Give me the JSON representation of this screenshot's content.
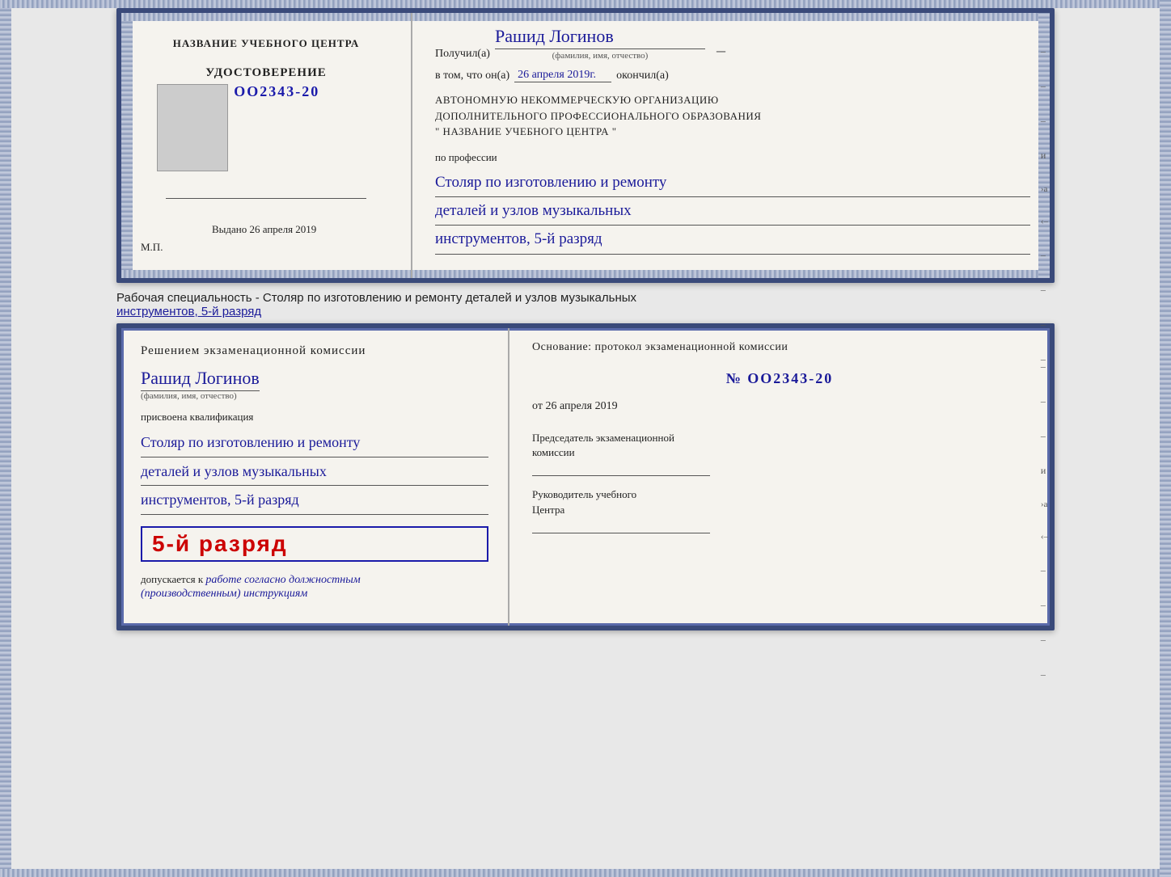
{
  "diploma": {
    "top_card": {
      "left": {
        "title": "НАЗВАНИЕ УЧЕБНОГО ЦЕНТРА",
        "cert_label": "УДОСТОВЕРЕНИЕ",
        "cert_number": "№ OO2343-20",
        "issued_prefix": "Выдано",
        "issued_date": "26 апреля 2019",
        "mp_label": "М.П."
      },
      "right": {
        "received_prefix": "Получил(а)",
        "recipient_name": "Рашид Логинов",
        "recipient_sublabel": "(фамилия, имя, отчество)",
        "date_prefix": "в том, что он(а)",
        "date_value": "26 апреля 2019г.",
        "completed_label": "окончил(а)",
        "org_line1": "АВТОНОМНУЮ НЕКОММЕРЧЕСКУЮ ОРГАНИЗАЦИЮ",
        "org_line2": "ДОПОЛНИТЕЛЬНОГО ПРОФЕССИОНАЛЬНОГО ОБРАЗОВАНИЯ",
        "org_line3": "\"   НАЗВАНИЕ УЧЕБНОГО ЦЕНТРА   \"",
        "profession_prefix": "по профессии",
        "profession_line1": "Столяр по изготовлению и ремонту",
        "profession_line2": "деталей и узлов музыкальных",
        "profession_line3": "инструментов, 5-й разряд"
      }
    },
    "specialty_text": "Рабочая специальность - Столяр по изготовлению и ремонту деталей и узлов музыкальных",
    "specialty_underline": "инструментов, 5-й разряд",
    "bottom_card": {
      "left": {
        "commission_text": "Решением экзаменационной комиссии",
        "person_name": "Рашид Логинов",
        "person_sublabel": "(фамилия, имя, отчество)",
        "qualification_prefix": "присвоена квалификация",
        "qualification_line1": "Столяр по изготовлению и ремонту",
        "qualification_line2": "деталей и узлов музыкальных",
        "qualification_line3": "инструментов, 5-й разряд",
        "rank_text": "5-й разряд",
        "allowed_prefix": "допускается к",
        "allowed_text": "работе согласно должностным",
        "allowed_text2": "(производственным) инструкциям"
      },
      "right": {
        "basis_text": "Основание: протокол экзаменационной  комиссии",
        "protocol_number": "№  OO2343-20",
        "date_prefix": "от",
        "date_value": "26 апреля 2019",
        "chairman_label": "Председатель экзаменационной",
        "chairman_label2": "комиссии",
        "head_label": "Руководитель учебного",
        "head_label2": "Центра"
      }
    }
  }
}
